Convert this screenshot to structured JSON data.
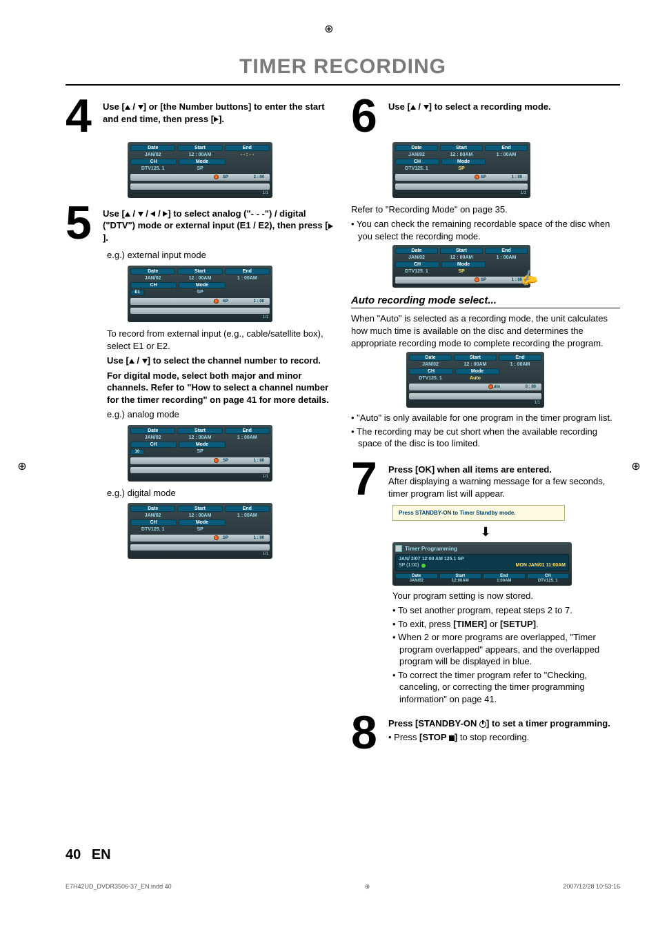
{
  "crop": "⊕",
  "title": "TIMER RECORDING",
  "steps": {
    "s4": {
      "num": "4",
      "text_a": "Use [",
      "text_b": " / ",
      "text_c": "] or [the Number buttons] to enter the start and end time, then press [",
      "text_d": "]."
    },
    "s5": {
      "num": "5",
      "text_a": "Use [",
      "text_b": " / ",
      "text_c": " / ",
      "text_d": " / ",
      "text_e": "] to select analog (\"- - -\") / digital (\"DTV\") mode or external input (E1 / E2), then press [",
      "text_f": "]."
    },
    "s6": {
      "num": "6",
      "text_a": "Use [",
      "text_b": " / ",
      "text_c": "] to select a recording mode."
    },
    "s7": {
      "num": "7",
      "head": "Press [OK] when all items are entered.",
      "body": "After displaying a warning message for a few seconds, timer program list will appear."
    },
    "s8": {
      "num": "8",
      "head_a": "Press [STANDBY-ON ",
      "head_b": "] to set a timer programming.",
      "bullet_a": "Press ",
      "bullet_b": "[STOP ",
      "bullet_c": "]",
      "bullet_d": " to stop recording."
    }
  },
  "col1": {
    "eg_ext": "e.g.) external input mode",
    "ext_note": "To record from external input (e.g., cable/satellite box), select E1 or E2.",
    "ch_instr_a": "Use [",
    "ch_instr_b": " / ",
    "ch_instr_c": "] to select the channel number to record.",
    "digital_note": "For digital mode, select both major and minor channels. Refer to \"How to select a channel number for the timer recording\" on page 41 for more details.",
    "eg_analog": "e.g.) analog mode",
    "eg_digital": "e.g.) digital mode"
  },
  "col2": {
    "refer": "Refer to \"Recording Mode\" on page 35.",
    "check": "You can check the remaining recordable space of the disc when you select the recording mode.",
    "auto_head": "Auto recording mode select...",
    "auto_body": "When \"Auto\" is selected as a recording mode, the unit calculates how much time is available on the disc and determines the appropriate recording mode to complete recording the program.",
    "auto_b1": "\"Auto\" is only available for one program in the timer program list.",
    "auto_b2": "The recording may be cut short when the available recording space of the disc is too limited.",
    "yellow": "Press STANDBY-ON to Timer Standby mode.",
    "stored": "Your program setting is now stored.",
    "b1": "To set another program, repeat steps 2 to 7.",
    "b2_a": "To exit, press ",
    "b2_b": "[TIMER]",
    "b2_c": " or ",
    "b2_d": "[SETUP]",
    "b2_e": ".",
    "b3": "When 2 or more programs are overlapped, \"Timer program overlapped\" appears, and the overlapped program will be displayed in blue.",
    "b4": "To correct the timer program refer to \"Checking, canceling, or correcting the timer programming information\" on page 41."
  },
  "osd": {
    "hdr_date": "Date",
    "hdr_start": "Start",
    "hdr_end": "End",
    "hdr_ch": "CH",
    "hdr_mode": "Mode",
    "jan02": "JAN/02",
    "t1200": "12 : 00AM",
    "dashes": "- - : - -",
    "t100": "1 : 00AM",
    "dtv": "DTV125. 1",
    "sp": "SP",
    "auto": "Auto",
    "e1": "E1",
    "ten": "10",
    "sp_lbl": "SP",
    "auto_lbl": "Auto",
    "t_2_00": "2 : 00",
    "t_1_00": "1 : 00",
    "t_0_00": "0 : 00",
    "pager": "1/1"
  },
  "timer_panel": {
    "title": "Timer Programming",
    "line1": "JAN/ 2/07 12:00 AM 125.1 SP",
    "sp": "SP  (1:00)",
    "clock": "MON JAN/01 11:00AM",
    "h_date": "Date",
    "h_start": "Start",
    "h_end": "End",
    "h_ch": "CH",
    "r_date": "JAN/02",
    "r_start": "12:00AM",
    "r_end": "1:00AM",
    "r_ch": "DTV125. 1"
  },
  "page_num": "40",
  "page_lang": "EN",
  "foot_left": "E7H42UD_DVDR3506-37_EN.indd   40",
  "foot_right": "2007/12/28   10:53:16"
}
